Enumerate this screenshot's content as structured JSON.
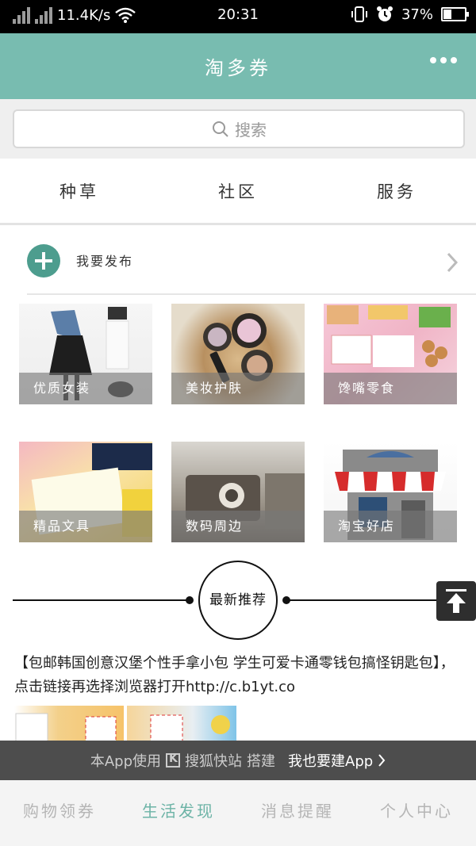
{
  "status_bar": {
    "net_speed": "11.4K/s",
    "time": "20:31",
    "battery": "37%",
    "battery_level": 0.37
  },
  "app_bar": {
    "title": "淘多券",
    "more_icon": "more-dots-icon"
  },
  "search": {
    "placeholder": "搜索"
  },
  "tabs": [
    "种草",
    "社区",
    "服务"
  ],
  "publish": {
    "label": "我要发布"
  },
  "categories": [
    {
      "label": "优质女装"
    },
    {
      "label": "美妆护肤"
    },
    {
      "label": "馋嘴零食"
    },
    {
      "label": "精品文具"
    },
    {
      "label": "数码周边"
    },
    {
      "label": "淘宝好店"
    }
  ],
  "section": {
    "title": "最新推荐"
  },
  "article": {
    "text": "【包邮韩国创意汉堡个性手拿小包 学生可爱卡通零钱包搞怪钥匙包】，点击链接再选择浏览器打开http://c.b1yt.co"
  },
  "promo": {
    "prefix": "本App使用",
    "brand": "搜狐快站",
    "suffix": "搭建",
    "cta": "我也要建App"
  },
  "bottom_nav": [
    {
      "label": "购物领券",
      "active": false
    },
    {
      "label": "生活发现",
      "active": true
    },
    {
      "label": "消息提醒",
      "active": false
    },
    {
      "label": "个人中心",
      "active": false
    }
  ],
  "colors": {
    "accent": "#78bcb0",
    "active_tab": "#6cb3a6"
  }
}
